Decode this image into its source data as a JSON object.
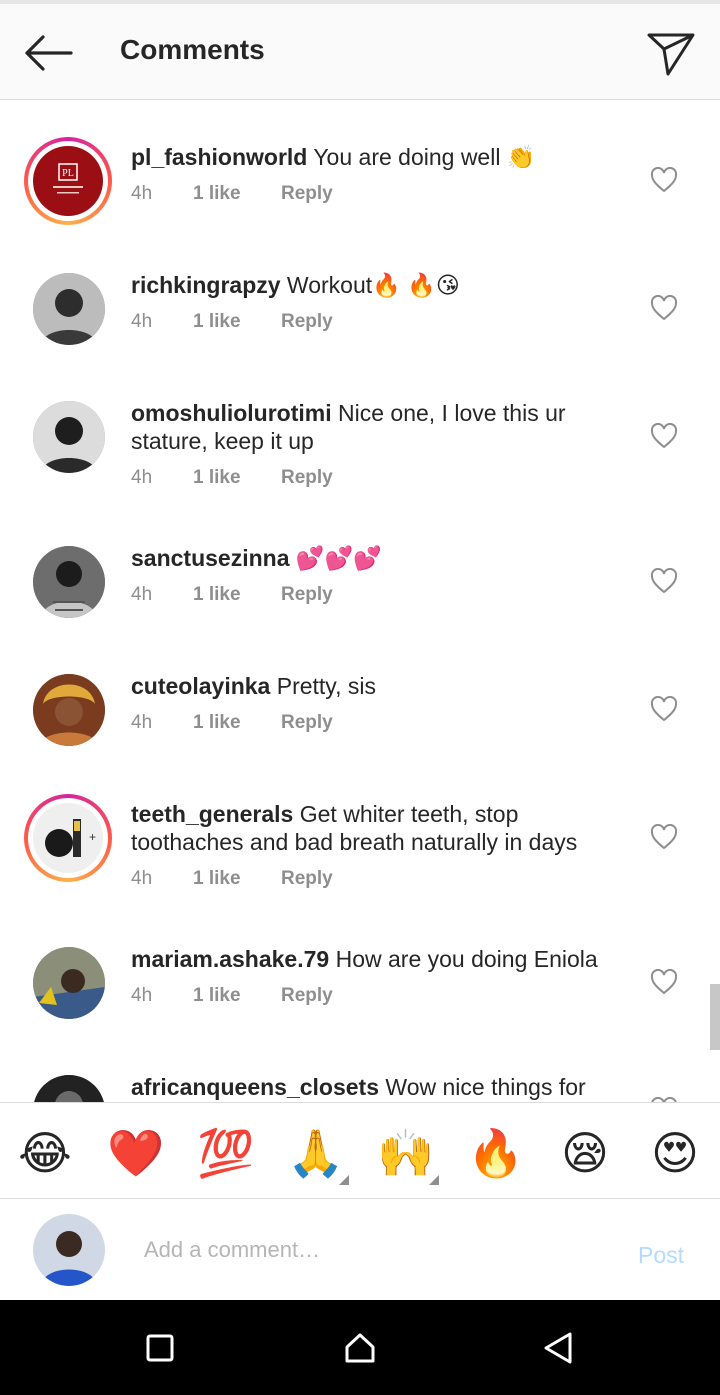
{
  "header": {
    "title": "Comments"
  },
  "comments": [
    {
      "user": "pl_fashionworld",
      "text": " You are doing well 👏",
      "time": "4h",
      "likes": "1 like",
      "reply": "Reply"
    },
    {
      "user": "richkingrapzy",
      "text": " Workout🔥 🔥😘",
      "time": "4h",
      "likes": "1 like",
      "reply": "Reply"
    },
    {
      "user": "omoshuliolurotimi",
      "text": " Nice one, I love this ur stature, keep it up",
      "time": "4h",
      "likes": "1 like",
      "reply": "Reply"
    },
    {
      "user": "sanctusezinna",
      "text": " 💕💕💕",
      "time": "4h",
      "likes": "1 like",
      "reply": "Reply"
    },
    {
      "user": "cuteolayinka",
      "text": " Pretty, sis",
      "time": "4h",
      "likes": "1 like",
      "reply": "Reply"
    },
    {
      "user": "teeth_generals",
      "text": " Get whiter teeth, stop toothaches and bad breath naturally in days",
      "time": "4h",
      "likes": "1 like",
      "reply": "Reply"
    },
    {
      "user": "mariam.ashake.79",
      "text": " How are you doing Eniola",
      "time": "4h",
      "likes": "1 like",
      "reply": "Reply"
    },
    {
      "user": "africanqueens_closets",
      "text": " Wow nice things for"
    }
  ],
  "emojis": [
    "😂",
    "❤️",
    "💯",
    "🙏",
    "🙌",
    "🔥",
    "😪",
    "😍"
  ],
  "composer": {
    "placeholder": "Add a comment…",
    "post_label": "Post"
  },
  "colors": {
    "accent_disabled": "#b3dbff",
    "secondary_text": "#8e8e8e",
    "story_ring": "#fd5949"
  }
}
